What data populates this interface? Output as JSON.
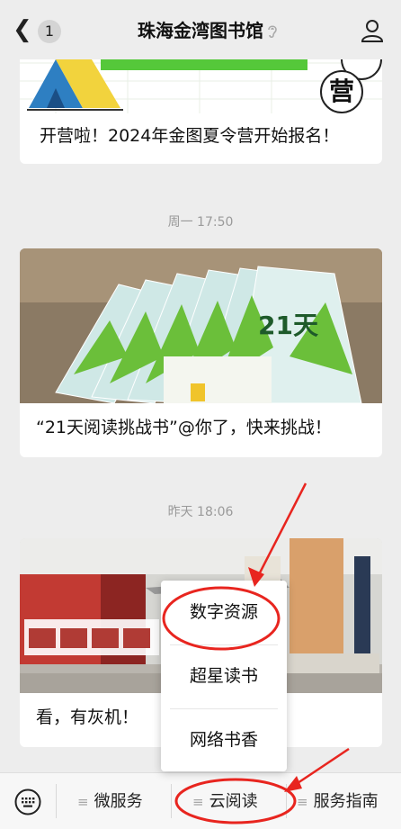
{
  "header": {
    "back_badge": "1",
    "title": "珠海金湾图书馆"
  },
  "feed": {
    "items": [
      {
        "caption": "开营啦！2024年金图夏令营开始报名！",
        "badge": "营"
      },
      {
        "timestamp": "周一 17:50",
        "caption": "“21天阅读挑战书”@你了，快来挑战！",
        "image_text": "21天"
      },
      {
        "timestamp": "昨天 18:06",
        "caption": "看，有灰机！"
      }
    ]
  },
  "popup_menu": {
    "items": [
      "数字资源",
      "超星读书",
      "网络书香"
    ]
  },
  "bottom_menu": {
    "items": [
      "微服务",
      "云阅读",
      "服务指南"
    ]
  },
  "colors": {
    "background": "#ededed",
    "annotation_red": "#e8251f"
  }
}
